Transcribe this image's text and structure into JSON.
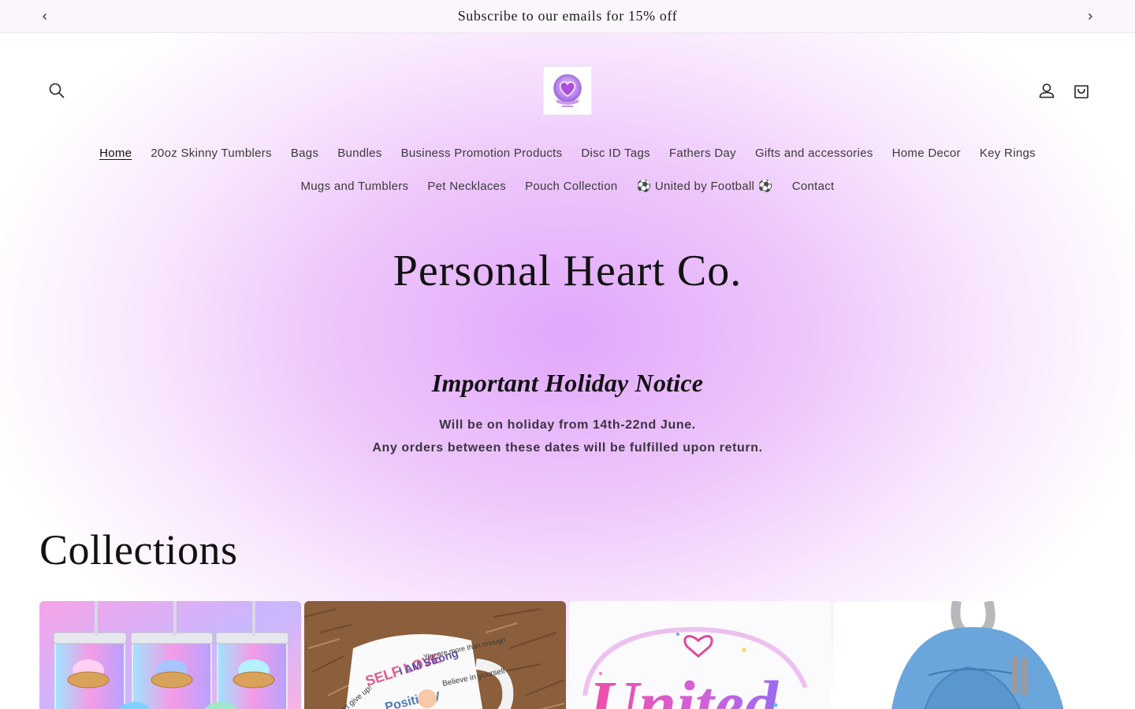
{
  "announcement": {
    "text": "Subscribe to our emails for 15% off",
    "prev_icon": "chevron-left-icon",
    "next_icon": "chevron-right-icon"
  },
  "header": {
    "search_icon": "search-icon",
    "account_icon": "account-icon",
    "cart_icon": "cart-icon",
    "logo_icon": "heart-logo-icon"
  },
  "nav": {
    "items": [
      {
        "label": "Home"
      },
      {
        "label": "20oz Skinny Tumblers"
      },
      {
        "label": "Bags"
      },
      {
        "label": "Bundles"
      },
      {
        "label": "Business Promotion Products"
      },
      {
        "label": "Disc ID Tags"
      },
      {
        "label": "Fathers Day"
      },
      {
        "label": "Gifts and accessories"
      },
      {
        "label": "Home Decor"
      },
      {
        "label": "Key Rings"
      },
      {
        "label": "Mugs and Tumblers"
      },
      {
        "label": "Pet Necklaces"
      },
      {
        "label": "Pouch Collection"
      },
      {
        "label": "⚽ United by Football ⚽"
      },
      {
        "label": "Contact"
      }
    ],
    "active": "Home"
  },
  "hero": {
    "title": "Personal Heart Co."
  },
  "notice": {
    "heading": "Important Holiday Notice",
    "line1": "Will be on holiday from 14th-22nd June.",
    "line2": "Any orders between these dates will be fulfilled upon return."
  },
  "collections": {
    "heading": "Collections",
    "cards": [
      {
        "image": "pastel-tumblers-image"
      },
      {
        "image": "self-love-mug-image",
        "text": [
          "SELF LOVE",
          "I AM Strong",
          "Positivity",
          "You are more than enough",
          "Believe in yourself",
          "Don't give up!"
        ]
      },
      {
        "image": "united-script-image",
        "text": "United"
      },
      {
        "image": "blue-backpack-image"
      }
    ]
  },
  "colors": {
    "accent": "#e2a7fb",
    "text": "#121212"
  }
}
